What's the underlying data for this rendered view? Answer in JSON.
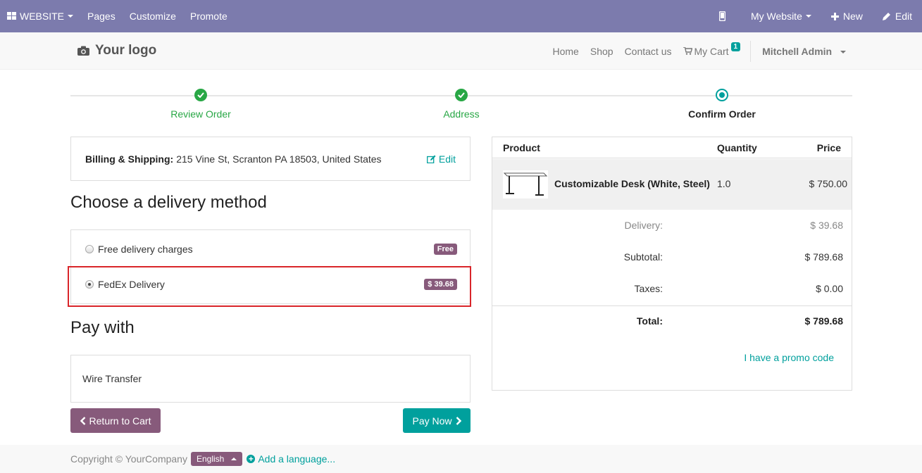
{
  "adminbar": {
    "website_label": "WEBSITE",
    "pages": "Pages",
    "customize": "Customize",
    "promote": "Promote",
    "my_website": "My Website",
    "new": "New",
    "edit": "Edit"
  },
  "header": {
    "logo": "Your logo",
    "nav": [
      "Home",
      "Shop",
      "Contact us"
    ],
    "cart_label": "My Cart",
    "cart_count": "1",
    "user": "Mitchell Admin"
  },
  "wizard": {
    "steps": [
      "Review Order",
      "Address",
      "Confirm Order"
    ]
  },
  "billing": {
    "label": "Billing & Shipping:",
    "address": "215 Vine St, Scranton PA 18503, United States",
    "edit": "Edit"
  },
  "delivery": {
    "title": "Choose a delivery method",
    "options": [
      {
        "label": "Free delivery charges",
        "price": "Free"
      },
      {
        "label": "FedEx Delivery",
        "price": "$ 39.68"
      }
    ]
  },
  "pay": {
    "title": "Pay with",
    "method": "Wire Transfer",
    "back": "Return to Cart",
    "pay_now": "Pay Now"
  },
  "cart": {
    "headers": {
      "product": "Product",
      "quantity": "Quantity",
      "price": "Price"
    },
    "item": {
      "name": "Customizable Desk (White, Steel)",
      "qty": "1.0",
      "price": "$ 750.00"
    },
    "delivery_label": "Delivery:",
    "delivery_value": "$ 39.68",
    "subtotal_label": "Subtotal:",
    "subtotal_value": "$ 789.68",
    "taxes_label": "Taxes:",
    "taxes_value": "$ 0.00",
    "total_label": "Total:",
    "total_value": "$ 789.68",
    "promo": "I have a promo code"
  },
  "footer": {
    "copyright": "Copyright © YourCompany",
    "language": "English",
    "add_language": "Add a language..."
  }
}
